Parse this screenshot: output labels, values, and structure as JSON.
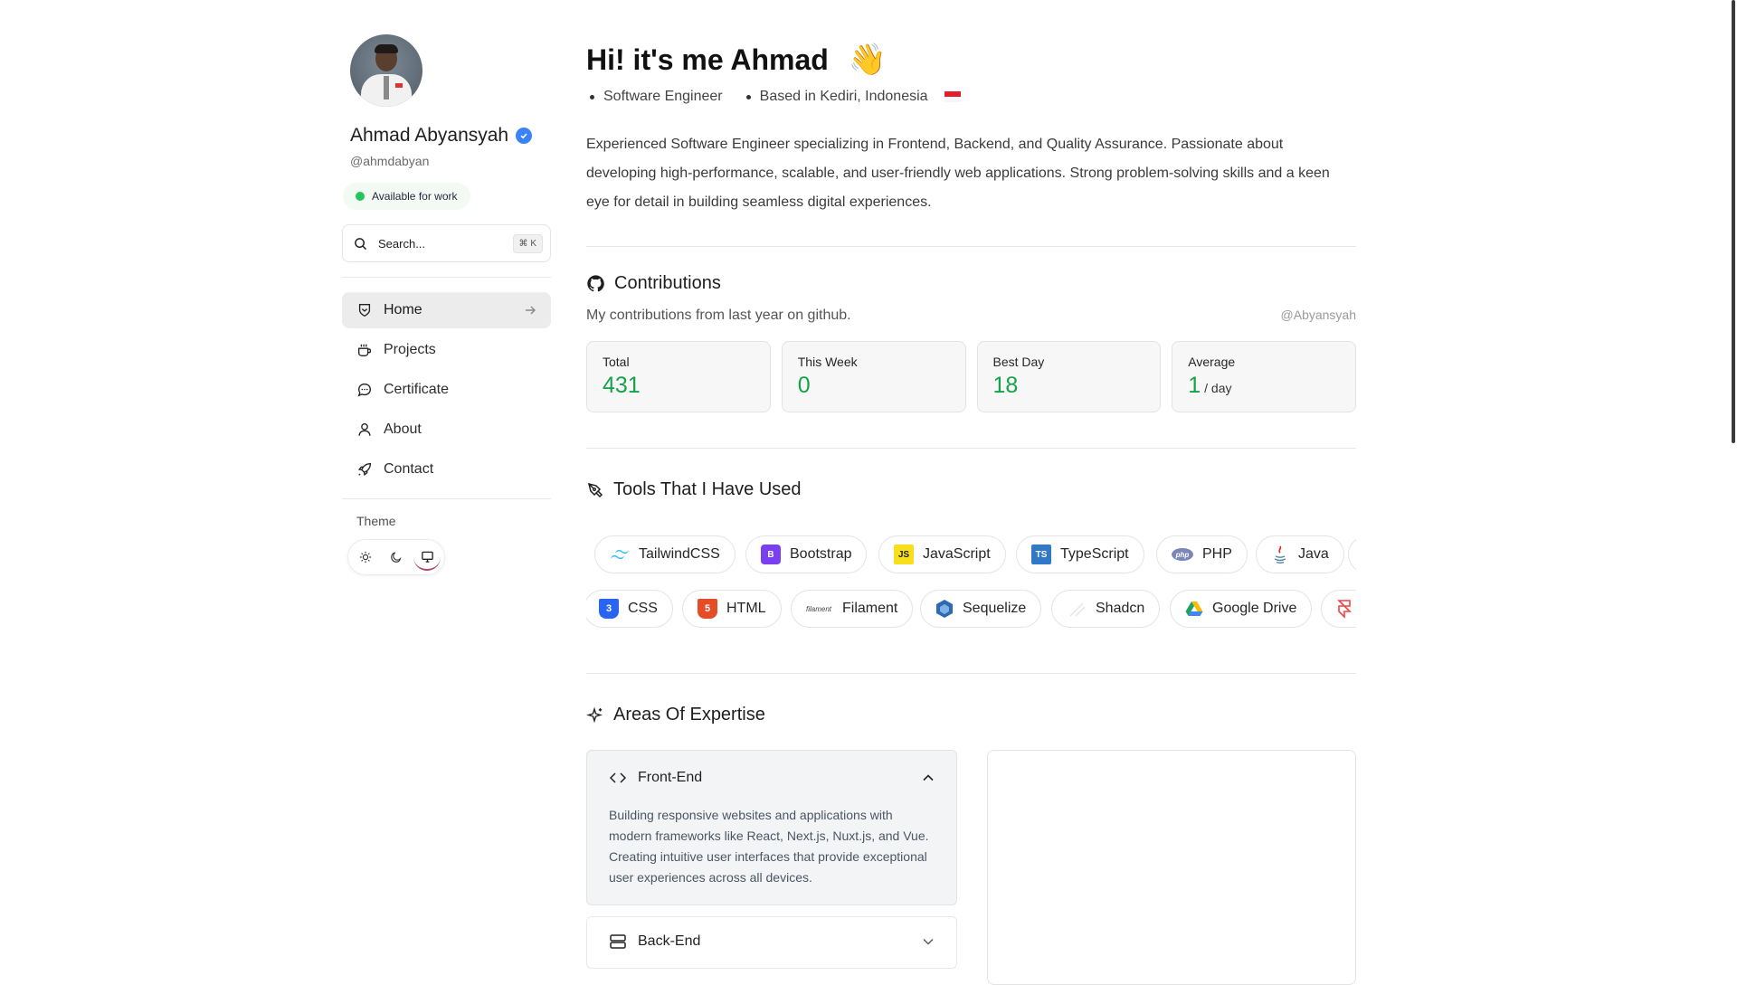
{
  "profile": {
    "name": "Ahmad Abyansyah",
    "handle": "@ahmdabyan",
    "status": "Available for work"
  },
  "search": {
    "placeholder": "Search...",
    "shortcut": "⌘ K"
  },
  "nav": {
    "items": [
      {
        "label": "Home",
        "icon": "home-icon",
        "active": true
      },
      {
        "label": "Projects",
        "icon": "coffee-cup-icon"
      },
      {
        "label": "Certificate",
        "icon": "chat-bubble-icon"
      },
      {
        "label": "About",
        "icon": "user-icon"
      },
      {
        "label": "Contact",
        "icon": "rocket-icon"
      }
    ]
  },
  "theme": {
    "label": "Theme",
    "options": [
      "sun-icon",
      "moon-icon",
      "monitor-icon"
    ],
    "selected": "monitor-icon"
  },
  "hero": {
    "greeting": "Hi! it's me Ahmad",
    "wave": "👋",
    "roles": [
      "Software Engineer",
      "Based in Kediri, Indonesia"
    ],
    "intro": "Experienced Software Engineer specializing in Frontend, Backend, and Quality Assurance. Passionate about developing high-performance, scalable, and user-friendly web applications. Strong problem-solving skills and a keen eye for detail in building seamless digital experiences."
  },
  "contributions": {
    "title": "Contributions",
    "description": "My contributions from last year on github.",
    "github_handle": "@Abyansyah",
    "stats": [
      {
        "label": "Total",
        "value": "431",
        "suffix": ""
      },
      {
        "label": "This Week",
        "value": "0",
        "suffix": ""
      },
      {
        "label": "Best Day",
        "value": "18",
        "suffix": ""
      },
      {
        "label": "Average",
        "value": "1",
        "suffix": "/ day"
      }
    ]
  },
  "tools": {
    "title": "Tools That I Have Used",
    "row1": [
      "TailwindCSS",
      "Bootstrap",
      "JavaScript",
      "TypeScript",
      "PHP",
      "Java"
    ],
    "row2": [
      "CSS",
      "HTML",
      "Filament",
      "Sequelize",
      "Shadcn",
      "Google Drive"
    ],
    "filament_logo_text": "filament",
    "php_logo_text": "php"
  },
  "expertise": {
    "title": "Areas Of Expertise",
    "items": [
      {
        "title": "Front-End",
        "expanded": true,
        "body": "Building responsive websites and applications with modern frameworks like React, Next.js, Nuxt.js, and Vue. Creating intuitive user interfaces that provide exceptional user experiences across all devices."
      },
      {
        "title": "Back-End",
        "expanded": false,
        "body": ""
      }
    ]
  },
  "colors": {
    "accent_green": "#15a34a",
    "status_dot": "#22c55e",
    "verified_blue": "#3b82f6"
  }
}
